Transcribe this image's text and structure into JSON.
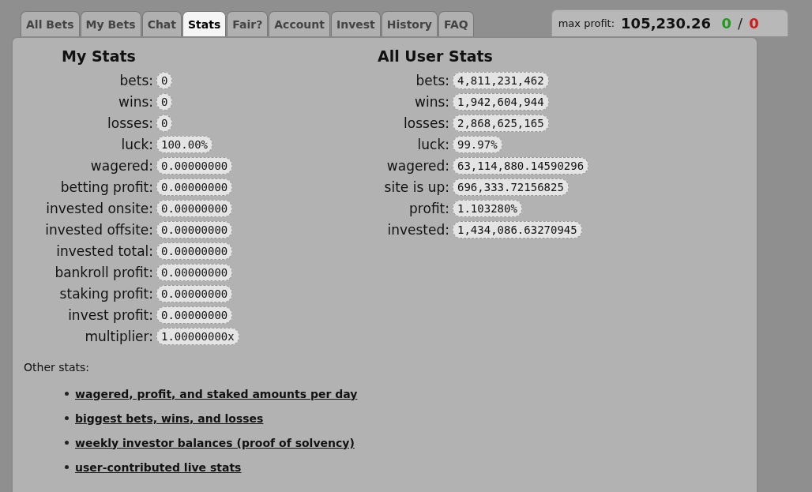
{
  "tabs": [
    {
      "label": "All Bets",
      "selected": false
    },
    {
      "label": "My Bets",
      "selected": false
    },
    {
      "label": "Chat",
      "selected": false
    },
    {
      "label": "Stats",
      "selected": true
    },
    {
      "label": "Fair?",
      "selected": false
    },
    {
      "label": "Account",
      "selected": false
    },
    {
      "label": "Invest",
      "selected": false
    },
    {
      "label": "History",
      "selected": false
    },
    {
      "label": "FAQ",
      "selected": false
    }
  ],
  "max_profit": {
    "label": "max profit:",
    "value": "105,230.26",
    "wins": "0",
    "separator": "/",
    "losses": "0"
  },
  "my_stats": {
    "title": "My Stats",
    "rows": [
      {
        "label": "bets:",
        "value": "0"
      },
      {
        "label": "wins:",
        "value": "0"
      },
      {
        "label": "losses:",
        "value": "0"
      },
      {
        "label": "luck:",
        "value": "100.00%"
      },
      {
        "label": "wagered:",
        "value": "0.00000000"
      },
      {
        "label": "betting profit:",
        "value": "0.00000000"
      },
      {
        "label": "invested onsite:",
        "value": "0.00000000"
      },
      {
        "label": "invested offsite:",
        "value": "0.00000000"
      },
      {
        "label": "invested total:",
        "value": "0.00000000"
      },
      {
        "label": "bankroll profit:",
        "value": "0.00000000"
      },
      {
        "label": "staking profit:",
        "value": "0.00000000"
      },
      {
        "label": "invest profit:",
        "value": "0.00000000"
      },
      {
        "label": "multiplier:",
        "value": "1.00000000x"
      }
    ]
  },
  "all_user_stats": {
    "title": "All User Stats",
    "rows": [
      {
        "label": "bets:",
        "value": "4,811,231,462"
      },
      {
        "label": "wins:",
        "value": "1,942,604,944"
      },
      {
        "label": "losses:",
        "value": "2,868,625,165"
      },
      {
        "label": "luck:",
        "value": "99.97%"
      },
      {
        "label": "wagered:",
        "value": "63,114,880.14590296"
      },
      {
        "label": "site is up:",
        "value": "696,333.72156825"
      },
      {
        "label": "profit:",
        "value": "1.103280%"
      },
      {
        "label": "invested:",
        "value": "1,434,086.63270945"
      }
    ]
  },
  "other_stats": {
    "heading": "Other stats:",
    "links": [
      "wagered, profit, and staked amounts per day",
      "biggest bets, wins, and losses",
      "weekly investor balances (proof of solvency)",
      "user-contributed live stats"
    ]
  }
}
